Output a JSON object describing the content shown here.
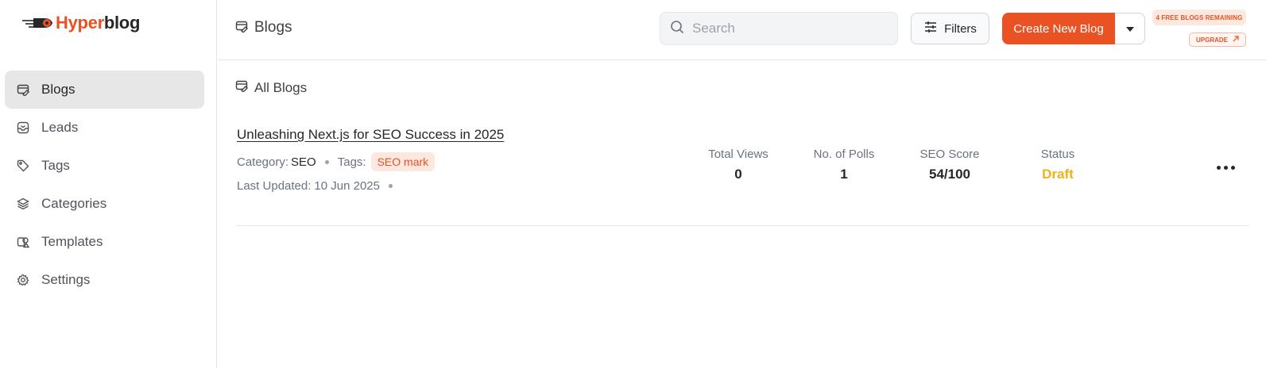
{
  "brand": {
    "name_part1": "Hyper",
    "name_part2": "blog",
    "accent": "#ea5123"
  },
  "sidebar": {
    "items": [
      {
        "label": "Blogs",
        "icon": "blog-icon",
        "active": true
      },
      {
        "label": "Leads",
        "icon": "inbox-icon",
        "active": false
      },
      {
        "label": "Tags",
        "icon": "tag-icon",
        "active": false
      },
      {
        "label": "Categories",
        "icon": "layers-icon",
        "active": false
      },
      {
        "label": "Templates",
        "icon": "template-icon",
        "active": false
      },
      {
        "label": "Settings",
        "icon": "gear-icon",
        "active": false
      }
    ]
  },
  "header": {
    "title": "Blogs",
    "search_placeholder": "Search",
    "filters_label": "Filters",
    "create_label": "Create New Blog",
    "remaining_label": "4 FREE BLOGS REMAINING",
    "upgrade_label": "UPGRADE"
  },
  "main": {
    "section_title": "All Blogs",
    "blogs": [
      {
        "title": "Unleashing Next.js for SEO Success in 2025",
        "category_label": "Category:",
        "category": "SEO",
        "tags_label": "Tags:",
        "tag": "SEO mark",
        "updated_label": "Last Updated:",
        "updated": "10 Jun 2025",
        "stats": {
          "views_label": "Total Views",
          "views": "0",
          "polls_label": "No. of Polls",
          "polls": "1",
          "seo_label": "SEO Score",
          "seo": "54/100",
          "status_label": "Status",
          "status": "Draft"
        }
      }
    ]
  }
}
